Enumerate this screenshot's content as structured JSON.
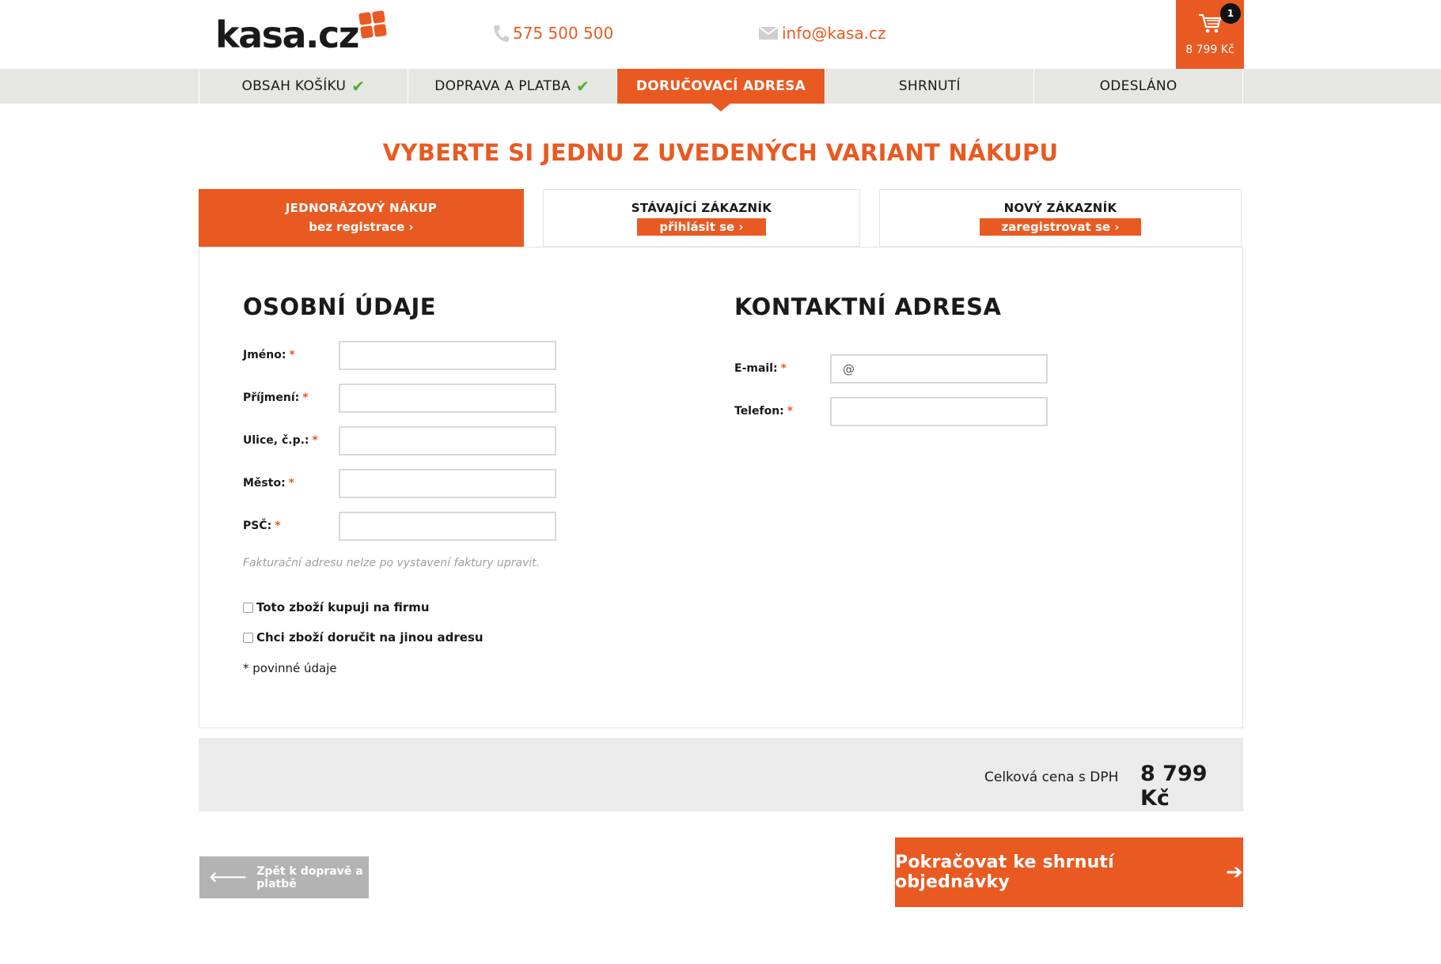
{
  "header": {
    "logo_text": "kasa.cz",
    "phone": "575 500 500",
    "email": "info@kasa.cz",
    "cart_count": "1",
    "cart_price": "8 799 Kč"
  },
  "steps": [
    {
      "label": "OBSAH KOŠÍKU",
      "done": true
    },
    {
      "label": "DOPRAVA A PLATBA",
      "done": true
    },
    {
      "label": "DORUČOVACÍ ADRESA",
      "active": true
    },
    {
      "label": "SHRNUTÍ"
    },
    {
      "label": "ODESLÁNO"
    }
  ],
  "page_title": "VYBERTE SI JEDNU Z UVEDENÝCH VARIANT NÁKUPU",
  "variants": [
    {
      "title": "JEDNORÁZOVÝ NÁKUP",
      "sub": "bez registrace ›",
      "active": true
    },
    {
      "title": "STÁVAJÍCÍ ZÁKAZNÍK",
      "sub": "přihlásit se ›"
    },
    {
      "title": "NOVÝ ZÁKAZNÍK",
      "sub": "zaregistrovat se ›"
    }
  ],
  "personal": {
    "title": "OSOBNÍ ÚDAJE",
    "fields": [
      {
        "label": "Jméno:",
        "value": ""
      },
      {
        "label": "Příjmení:",
        "value": ""
      },
      {
        "label": "Ulice, č.p.:",
        "value": ""
      },
      {
        "label": "Město:",
        "value": ""
      },
      {
        "label": "PSČ:",
        "value": ""
      }
    ],
    "note": "Fakturační adresu nelze po vystavení faktury upravit.",
    "checkbox_company": "Toto zboží kupuji na firmu",
    "checkbox_other_address": "Chci zboží doručit na jinou adresu",
    "required_note": "* povinné údaje"
  },
  "contact": {
    "title": "KONTAKTNÍ ADRESA",
    "email_label": "E-mail:",
    "email_value": "@",
    "phone_label": "Telefon:",
    "phone_value": ""
  },
  "required_mark": "*",
  "total": {
    "label": "Celková cena s DPH",
    "value": "8 799 Kč"
  },
  "buttons": {
    "back": "Zpět k dopravě a platbě",
    "next": "Pokračovat ke shrnutí objednávky"
  },
  "colors": {
    "accent": "#e85a22",
    "check": "#4caf2a"
  }
}
